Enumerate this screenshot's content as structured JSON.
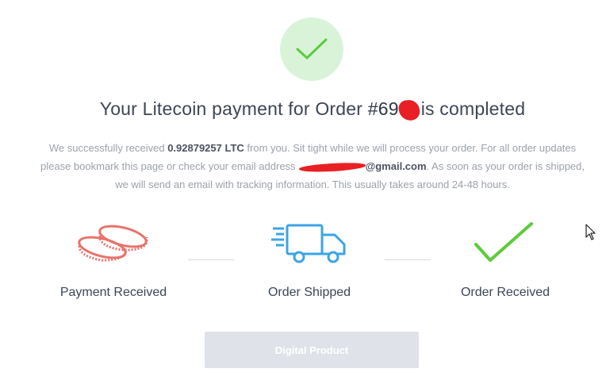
{
  "header": {
    "title_prefix": "Your Litecoin payment for Order ",
    "order_number": "#69",
    "title_suffix": "is completed"
  },
  "message": {
    "part1": "We successfully received ",
    "amount": "0.92879257 LTC",
    "part2": " from you. Sit tight while we will process your order. For all order updates please bookmark this page or check your email address",
    "email_domain": "@gmail.com",
    "part3": ". As soon as your order is shipped, we will send an email with tracking information. This usually takes around 24-48 hours."
  },
  "steps": [
    {
      "label": "Payment Received",
      "icon": "coins-icon"
    },
    {
      "label": "Order Shipped",
      "icon": "truck-icon"
    },
    {
      "label": "Order Received",
      "icon": "checkmark-icon"
    }
  ],
  "button": {
    "label": "Digital Product"
  },
  "colors": {
    "success_bg": "#d9f3d9",
    "success_green": "#5ccb3c",
    "coins_red": "#e8736a",
    "truck_blue": "#3ba4e5",
    "redaction": "#e81f25",
    "button_bg": "#dfe2e8"
  }
}
